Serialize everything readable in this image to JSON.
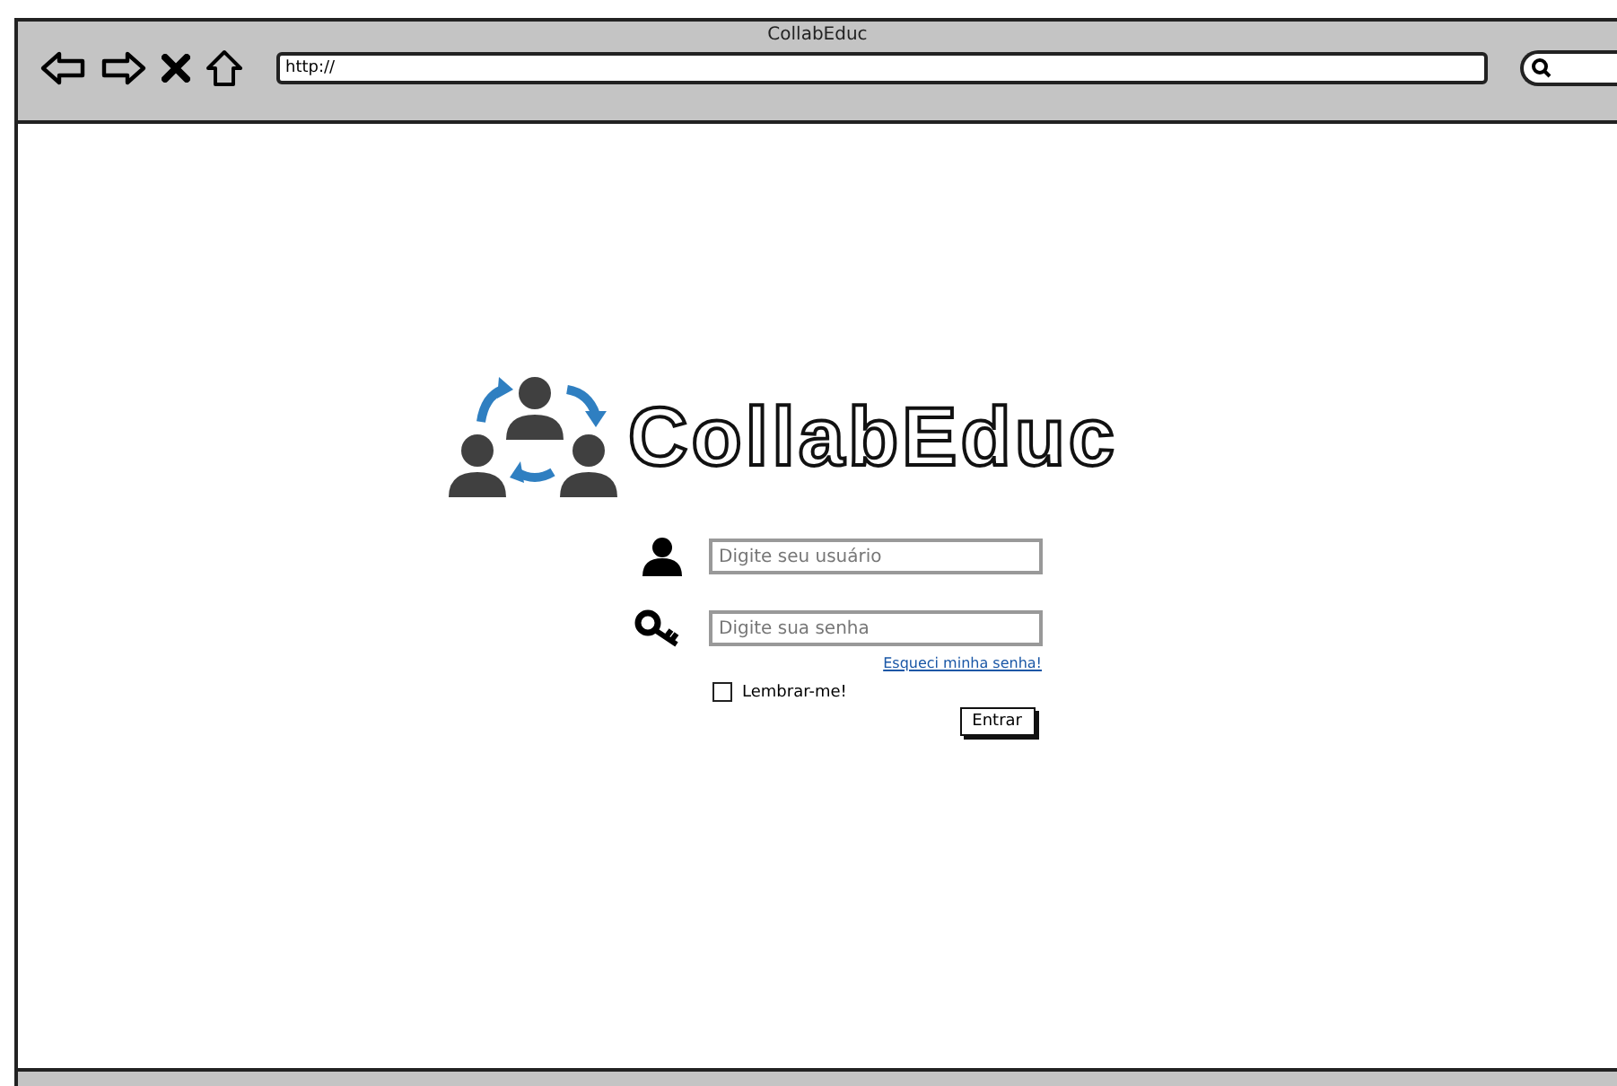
{
  "window": {
    "title": "CollabEduc"
  },
  "address_bar": {
    "value": "http://"
  },
  "logo": {
    "text": "CollabEduc"
  },
  "login": {
    "username": {
      "placeholder": "Digite seu usuário"
    },
    "password": {
      "placeholder": "Digite sua senha"
    },
    "forgot_link": "Esqueci minha senha!",
    "remember": {
      "label": "Lembrar-me!",
      "checked": false
    },
    "submit": "Entrar"
  }
}
